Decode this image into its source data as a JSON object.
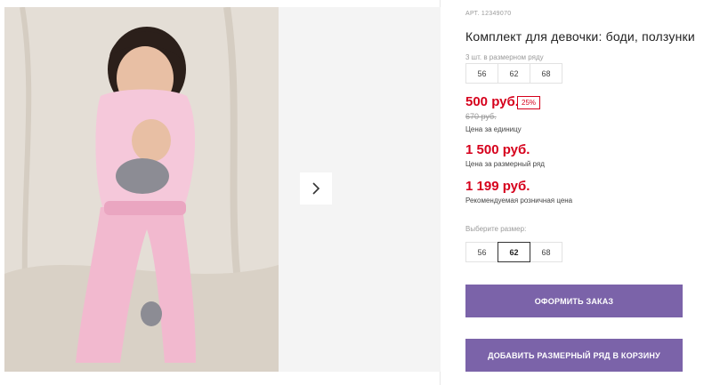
{
  "product": {
    "article_label": "АРТ. 12349070",
    "title": "Комплект для девочки: боди, ползунки"
  },
  "gallery": {
    "image_alt": "Little bunny",
    "next_icon": "chevron-right-icon"
  },
  "size_set": {
    "label": "3 шт. в размерном ряду",
    "sizes": [
      "56",
      "62",
      "68"
    ]
  },
  "pricing": {
    "unit_price": "500 руб.",
    "discount": "25%",
    "old_price": "670 руб.",
    "unit_note": "Цена за единицу",
    "set_price": "1 500 руб.",
    "set_note": "Цена за размерный ряд",
    "rrp_price": "1 199 руб.",
    "rrp_note": "Рекомендуемая розничная цена"
  },
  "size_select": {
    "label": "Выберите размер:",
    "options": [
      "56",
      "62",
      "68"
    ],
    "selected": "62"
  },
  "actions": {
    "order_label": "Оформить заказ",
    "cart_label": "Добавить размерный ряд в корзину"
  },
  "colors": {
    "accent": "#7b63a9",
    "price": "#d6001c"
  }
}
